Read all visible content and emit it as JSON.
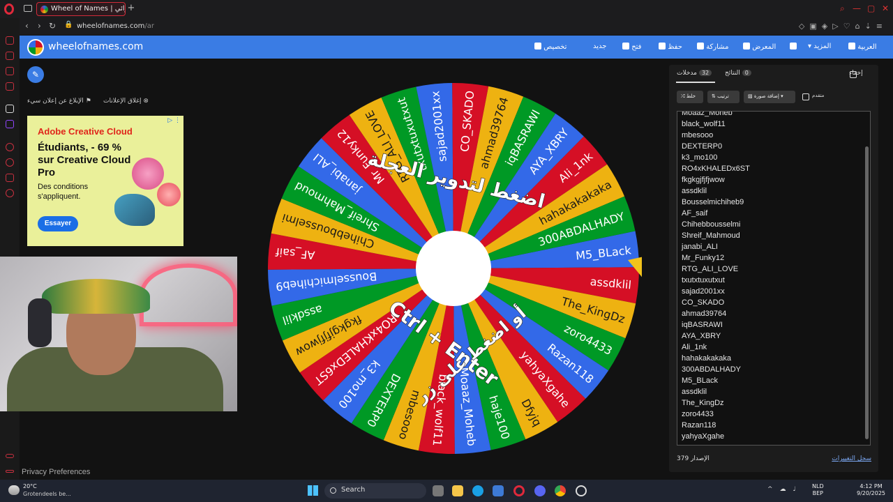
{
  "browser": {
    "tab_title": "Wheel of Names | عشوائي",
    "url_host": "wheelofnames.com",
    "url_path": "/ar"
  },
  "site": {
    "title": "wheelofnames.com",
    "menu": [
      "تخصيص",
      "جديد",
      "فتح",
      "حفظ",
      "مشاركة",
      "المعرض",
      "المزيد",
      "العربية"
    ]
  },
  "ads": {
    "report_link": "الإبلاغ عن إعلان سيء",
    "close_link": "إغلاق الإعلانات",
    "brand": "Adobe Creative Cloud",
    "headline": "Étudiants, - 69 % sur Creative Cloud Pro",
    "sub": "Des conditions s'appliquent.",
    "cta": "Essayer"
  },
  "wheel": {
    "colors": [
      "#3369e8",
      "#d50f25",
      "#eeb211",
      "#009925"
    ],
    "pointer_color": "#f2c21b",
    "overlay_top": "اضغط لتدوير العجلة",
    "overlay_bottom": "أو اضغط على زر",
    "overlay_keys": "Ctrl + Enter"
  },
  "panel": {
    "tab_entries": "مدخلات",
    "entries_count": "32",
    "tab_results": "النتائج",
    "results_count": "0",
    "hide_label": "إخفاء",
    "shuffle_label": "خلط",
    "sort_label": "ترتيب",
    "add_image_label": "إضافة صورة",
    "advanced_label": "متقدم",
    "entries": [
      "Moaaz_Moheb",
      "black_wolf11",
      "mbesooo",
      "DEXTERP0",
      "k3_mo100",
      "RO4xKHALEDx6ST",
      "fkgkgjfjfjwow",
      "assdklil",
      "Bousselmichiheb9",
      "AF_saif",
      "Chihebbousselmi",
      "Shreif_Mahmoud",
      "janabi_ALI",
      "Mr_Funky12",
      "RTG_ALI_LOVE",
      "txutxtuxutxut",
      "sajad2001xx",
      "CO_SKADO",
      "ahmad39764",
      "iqBASRAWI",
      "AYA_XBRY",
      "Ali_1nk",
      "hahakakakaka",
      "300ABDALHADY",
      "M5_BLack",
      "assdklil",
      "The_KingDz",
      "zoro4433",
      "Razan118",
      "yahyaXgahe"
    ],
    "wheel_entries": [
      "M5_BLack",
      "assdklil",
      "The_KingDz",
      "zoro4433",
      "Razan118",
      "yahyaXgahe",
      "Dfyjq",
      "haje100",
      "Moaaz_Moheb",
      "black_wolf11",
      "mbesooo",
      "DEXTERP0",
      "k3_mo100",
      "RO4xKHALEDx6ST",
      "fkgkgjfjfjwow",
      "assdklil",
      "Bousselmichiheb9",
      "AF_saif",
      "Chihebbousselmi",
      "Shreif_Mahmoud",
      "janabi_ALI",
      "Mr_Funky12",
      "RTG_ALI_LOVE",
      "txutxtuxutxut",
      "sajad2001xx",
      "CO_SKADO",
      "ahmad39764",
      "iqBASRAWI",
      "AYA_XBRY",
      "Ali_1nk",
      "hahakakakaka",
      "300ABDALHADY"
    ],
    "version_label": "الإصدار",
    "version_number": "379",
    "changelog_label": "سجل التغييرات"
  },
  "privacy": "Privacy Preferences",
  "taskbar": {
    "weather_temp": "20°C",
    "weather_desc": "Grotendeels be...",
    "search": "Search",
    "lang_top": "NLD",
    "lang_bottom": "BEP",
    "time": "4:12 PM",
    "date": "9/20/2025"
  }
}
